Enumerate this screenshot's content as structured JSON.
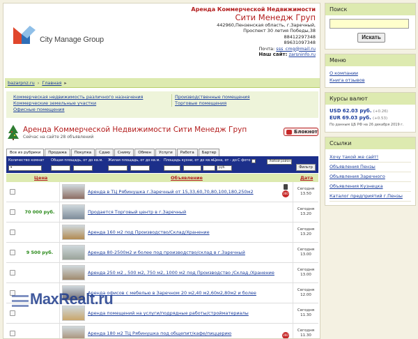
{
  "header": {
    "brand": "City Manage Group",
    "tagline": "Аренда Коммерческой Недвижимости",
    "company": "Сити Менедж Груп",
    "address1": "442960,Пензенская область, г.Заречный,",
    "address2": "Проспект 30 летия Победы,38",
    "phone1": "88412297348",
    "phone2": "89631097348",
    "email_label": "Почта:",
    "email": "sss_cmg@mail.ru",
    "site_label": "Наш сайт:",
    "site": "zarsninfo.ru"
  },
  "breadcrumb": [
    "bazarpnz.ru",
    "Главная"
  ],
  "categories": {
    "left": [
      "Коммерческая недвижимость различного назначения",
      "Коммерческие земельные участки",
      "Офисные помещения"
    ],
    "right": [
      "Производственные помещения",
      "Торговые помещения"
    ]
  },
  "ad_header": {
    "title": "Аренда Коммерческой Недвижимости Сити Менедж Груп",
    "online": "Сейчас на сайте 28 объявлений",
    "notebook": "Блокнот"
  },
  "tabs": [
    "Все из рубрики",
    "Продажа",
    "Покупка",
    "Сдаю",
    "Сниму",
    "Обмен",
    "Услуги",
    "Работа",
    "Бартер"
  ],
  "filter": {
    "rooms": "Количество комнат",
    "area": "Общая площадь, от до кв.м.",
    "living": "Жилая площадь, от до кв.м.",
    "kitchen": "Площадь кухни, от до кв.м.",
    "price": "Цена, от - до",
    "currency": "руб.",
    "photo": "С фото",
    "district": "Любой район",
    "apply": "Фильтр"
  },
  "table": {
    "col_price": "Цена",
    "col_ad": "Объявление",
    "col_date": "Дата",
    "rows": [
      {
        "price": "",
        "title": "Аренда в ТЦ Рябинушка г.Заречный от 15,33,60,70,80,100,180,250м2",
        "day": "Сегодня",
        "time": "13.50",
        "badge": "360"
      },
      {
        "price": "70 000 руб.",
        "title": "Продается Торговый центр в г.Заречный",
        "day": "Сегодня",
        "time": "13.20",
        "badge": ""
      },
      {
        "price": "",
        "title": "Аренда 160 м2 под Производство/Склад/Хранение",
        "day": "Сегодня",
        "time": "13.20",
        "badge": ""
      },
      {
        "price": "9 500 руб.",
        "title": "Аренда 80-2500м2 и более под производство/склад в г.Заречный",
        "day": "Сегодня",
        "time": "13.00",
        "badge": ""
      },
      {
        "price": "",
        "title": "Аренда 250 м2 , 500 м2, 750 м2, 1000 м2 под Производство /Склад /Хранение",
        "day": "Сегодня",
        "time": "13.00",
        "badge": ""
      },
      {
        "price": "",
        "title": "Аренда офисов с мебелью в Заречном 20 м2,40 м2,60м2,80м2 и более",
        "day": "Сегодня",
        "time": "12.00",
        "badge": ""
      },
      {
        "price": "",
        "title": "Аренда помещений на услуги/подрядные работы/стройматериалы",
        "day": "Сегодня",
        "time": "11.30",
        "badge": ""
      },
      {
        "price": "",
        "title": "Аренда 180 м2 ТЦ Рябинушка под общепит/кафе/пиццерию",
        "day": "Сегодня",
        "time": "11.30",
        "badge": "360"
      }
    ]
  },
  "watermark": {
    "brand": "MaxRealt.ru"
  },
  "sidebar": {
    "search_title": "Поиск",
    "search_button": "Искать",
    "menu_title": "Меню",
    "menu_items": [
      "О компании",
      "Книга отзывов"
    ],
    "currency_title": "Курсы валют",
    "usd": {
      "code": "USD",
      "value": "62.03 руб.",
      "delta": "(+0.26)"
    },
    "eur": {
      "code": "EUR",
      "value": "69.03 руб.",
      "delta": "(+0.53)"
    },
    "currency_source": "По данным ЦБ РФ на 26 декабря 2019 г.",
    "links_title": "Ссылки",
    "links": [
      "Хочу такой же сайт!",
      "Объявления Пензы",
      "Объявления Заречного",
      "Объявления Кузнецка",
      "Каталог предприятий г.Пензы"
    ]
  }
}
